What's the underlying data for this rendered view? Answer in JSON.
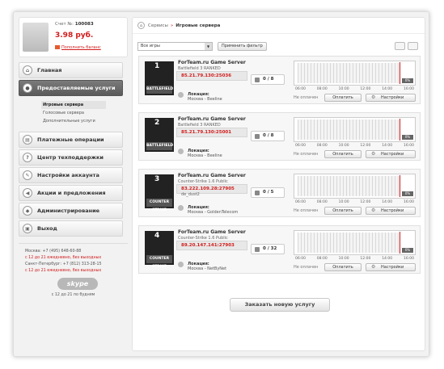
{
  "account": {
    "number_label": "Счет №:",
    "number": "100083",
    "balance": "3.98 руб.",
    "topup": "Пополнить баланс"
  },
  "nav": [
    {
      "label": "Главная",
      "icon": "home-icon"
    },
    {
      "label": "Предоставляемые услуги",
      "icon": "user-icon",
      "active": true
    },
    {
      "label": "Платежные операции",
      "icon": "wallet-icon"
    },
    {
      "label": "Центр техподдержки",
      "icon": "support-icon"
    },
    {
      "label": "Настройки аккаунта",
      "icon": "wrench-icon"
    },
    {
      "label": "Акции и предложения",
      "icon": "megaphone-icon"
    },
    {
      "label": "Администрирование",
      "icon": "admin-icon"
    },
    {
      "label": "Выход",
      "icon": "lock-icon"
    }
  ],
  "subnav": [
    "Игровые сервера",
    "Голосовые сервера",
    "Дополнительные услуги"
  ],
  "contacts": {
    "moscow": "Москва: +7 (495) 648-60-88",
    "moscow_hours": "с 12 до 21 ежедневно, без выходных",
    "spb": "Санкт-Петербург: +7 (812) 313-28-15",
    "spb_hours": "с 12 до 21 ежедневно, без выходных",
    "skype": "skype",
    "skype_hours": "с 12 до 21 по будням"
  },
  "breadcrumb": {
    "parent": "Сервисы",
    "separator": "»",
    "current": "Игровые сервера"
  },
  "filter": {
    "select_value": "Все игры",
    "apply_label": "Применить фильтр"
  },
  "times": [
    "06:00",
    "08:00",
    "10:00",
    "12:00",
    "14:00",
    "16:00"
  ],
  "servers": [
    {
      "num": "1",
      "art": "BATTLEFIELD",
      "title": "ForTeam.ru Game Server",
      "game": "Battlefield 3 RANKED",
      "ip": "85.21.79.130:25036",
      "map": "",
      "slots": "0 / 8",
      "location_label": "Локация:",
      "location": "Москва - Beeline",
      "status": "Не оплачен",
      "pay": "Оплатить",
      "settings": "Настройки",
      "pct": "0%"
    },
    {
      "num": "2",
      "art": "BATTLEFIELD",
      "title": "ForTeam.ru Game Server",
      "game": "Battlefield 3 RANKED",
      "ip": "85.21.79.130:25001",
      "map": "",
      "slots": "0 / 8",
      "location_label": "Локация:",
      "location": "Москва - Beeline",
      "status": "Не оплачен",
      "pay": "Оплатить",
      "settings": "Настройки",
      "pct": "0%"
    },
    {
      "num": "3",
      "art": "COUNTER STRIKE",
      "title": "ForTeam.ru Game Server",
      "game": "Counter-Strike 1.6 Public",
      "ip": "83.222.109.28:27905",
      "map": "de_dust2",
      "slots": "0 / 5",
      "location_label": "Локация:",
      "location": "Москва - GoldenTelecom",
      "status": "Не оплачен",
      "pay": "Оплатить",
      "settings": "Настройки",
      "pct": "0%"
    },
    {
      "num": "4",
      "art": "COUNTER STRIKE",
      "title": "ForTeam.ru Game Server",
      "game": "Counter-Strike 1.6 Public",
      "ip": "89.20.147.141:27903",
      "map": "",
      "slots": "0 / 32",
      "location_label": "Локация:",
      "location": "Москва - NetByNet",
      "status": "Не оплачен",
      "pay": "Оплатить",
      "settings": "Настройки",
      "pct": "0%"
    }
  ],
  "order_label": "Заказать новую услугу"
}
